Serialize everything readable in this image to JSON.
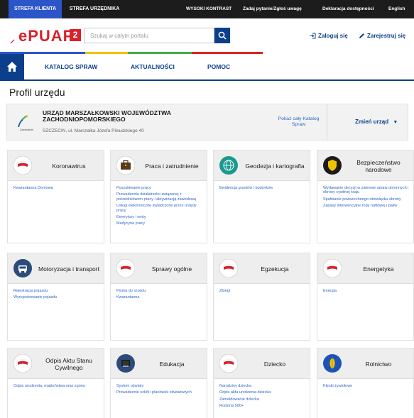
{
  "topbar": {
    "tab_klient": "STREFA KLIENTA",
    "tab_urzednik": "STREFA URZĘDNIKA",
    "contrast": "WYSOKI KONTRAST",
    "ask": "Zadaj pytanie/Zgłoś uwagę",
    "accessibility": "Deklaracja dostępności",
    "language": "English"
  },
  "header": {
    "logo_text": "ePUAP",
    "logo_num": "2",
    "search_placeholder": "Szukaj w całym portalu",
    "login": "Zaloguj się",
    "register": "Zarejestruj się"
  },
  "nav": {
    "items": [
      "KATALOG SPRAW",
      "AKTUALNOŚCI",
      "POMOC"
    ]
  },
  "page_title": "Profil urzędu",
  "office": {
    "name": "URZĄD MARSZAŁKOWSKI WOJEWÓDZTWA ZACHODNIOPOMORSKIEGO",
    "address": "SZCZECIN, ul. Marszałka Józefa Piłsudskiego 40",
    "logo_caption": "Zachodnie",
    "catalog_link": "Pokaż cały Katalog Spraw",
    "change": "Zmień urząd"
  },
  "colors": {
    "navy": "#0b3f8c",
    "red": "#d9222a",
    "link": "#2f66c9",
    "topbar_active": "#2b55c8"
  },
  "cards": [
    {
      "title": "Koronawirus",
      "icon": "poland-flag-icon",
      "links": [
        "Kwarantanna Domowa"
      ]
    },
    {
      "title": "Praca i zatrudnienie",
      "icon": "briefcase-icon",
      "links": [
        "Poszukiwanie pracy",
        "Prowadzenie działalności związanej z pośrednictwem pracy i aktywizacją zawodową",
        "Usługi elektroniczne świadczone przez urzędy pracy",
        "Emerytury i renty",
        "Medycyna pracy"
      ]
    },
    {
      "title": "Geodezja i kartografia",
      "icon": "globe-icon",
      "links": [
        "Ewidencja gruntów i budynków"
      ]
    },
    {
      "title": "Bezpieczeństwo narodowe",
      "icon": "shield-icon",
      "links": [
        "Wydawanie decyzji w zakresie spraw obronnych i obrony cywilnej kraju",
        "Spełnianie powszechnego obowiązku obrony",
        "Zapasy interwencyjne ropy naftowej i paliw"
      ]
    },
    {
      "title": "Motoryzacja i transport",
      "icon": "car-icon",
      "links": [
        "Rejestracja pojazdu",
        "Wyrejestrowanie pojazdu"
      ]
    },
    {
      "title": "Sprawy ogólne",
      "icon": "poland-flag-icon",
      "links": [
        "Pisma do urzędu",
        "Kwarantanna"
      ]
    },
    {
      "title": "Egzekucja",
      "icon": "poland-flag-icon",
      "links": [
        "Zbiegi"
      ]
    },
    {
      "title": "Energetyka",
      "icon": "poland-flag-icon",
      "links": [
        "Energia"
      ]
    },
    {
      "title": "Odpis Aktu Stanu Cywilnego",
      "icon": "poland-flag-icon",
      "links": [
        "Odpis urodzenia, małżeństwa oraz zgonu"
      ]
    },
    {
      "title": "Edukacja",
      "icon": "school-icon",
      "links": [
        "System oświaty",
        "Prowadzenie szkół i placówek oświatowych"
      ]
    },
    {
      "title": "Dziecko",
      "icon": "poland-flag-icon",
      "links": [
        "Narodziny dziecka",
        "Odpis aktu urodzenia dziecka",
        "Zameldowanie dziecka",
        "Rodzina 500+"
      ]
    },
    {
      "title": "Rolnictwo",
      "icon": "wheat-icon",
      "links": [
        "Klęski żywiołowe"
      ]
    }
  ]
}
